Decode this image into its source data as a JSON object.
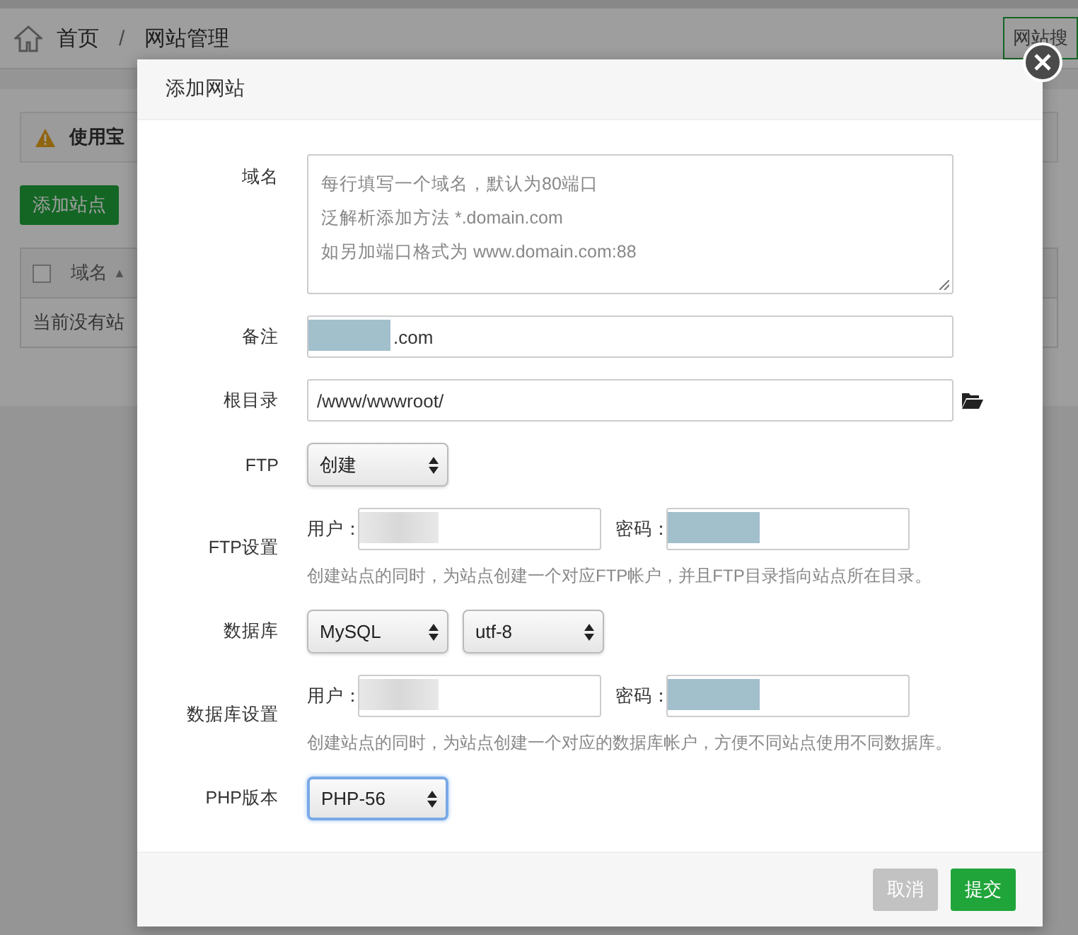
{
  "breadcrumb": {
    "home": "首页",
    "separator": "/",
    "current": "网站管理"
  },
  "search_button": "网站搜",
  "notice": "使用宝",
  "add_button": "添加站点",
  "table": {
    "select_all_checked": false,
    "columns": [
      {
        "label": "域名",
        "sort_icon": "▲"
      }
    ],
    "empty_text": "当前没有站"
  },
  "dialog": {
    "title": "添加网站",
    "fields": [
      {
        "kind": "textarea",
        "label": "域名",
        "placeholder_lines": [
          "每行填写一个域名，默认为80端口",
          "泛解析添加方法 *.domain.com",
          "如另加端口格式为 www.domain.com:88"
        ]
      },
      {
        "kind": "text",
        "label": "备注",
        "value": ".com",
        "redacted": true
      },
      {
        "kind": "path",
        "label": "根目录",
        "value": "/www/wwwroot/"
      },
      {
        "kind": "select",
        "label": "FTP",
        "selects": [
          {
            "value": "创建",
            "focused": false
          }
        ]
      },
      {
        "kind": "credentials",
        "label": "FTP设置",
        "user_label": "用户：",
        "user_blurred": true,
        "password_label": "密码：",
        "password_redacted": true,
        "help": "创建站点的同时，为站点创建一个对应FTP帐户，并且FTP目录指向站点所在目录。"
      },
      {
        "kind": "select",
        "label": "数据库",
        "selects": [
          {
            "value": "MySQL",
            "focused": false
          },
          {
            "value": "utf-8",
            "focused": false
          }
        ]
      },
      {
        "kind": "credentials",
        "label": "数据库设置",
        "user_label": "用户：",
        "user_blurred": true,
        "password_label": "密码：",
        "password_redacted": true,
        "help": "创建站点的同时，为站点创建一个对应的数据库帐户，方便不同站点使用不同数据库。"
      },
      {
        "kind": "select",
        "label": "PHP版本",
        "selects": [
          {
            "value": "PHP-56",
            "focused": true
          }
        ]
      }
    ],
    "buttons": [
      {
        "label": "取消",
        "kind": "cancel"
      },
      {
        "label": "提交",
        "kind": "submit"
      }
    ]
  }
}
